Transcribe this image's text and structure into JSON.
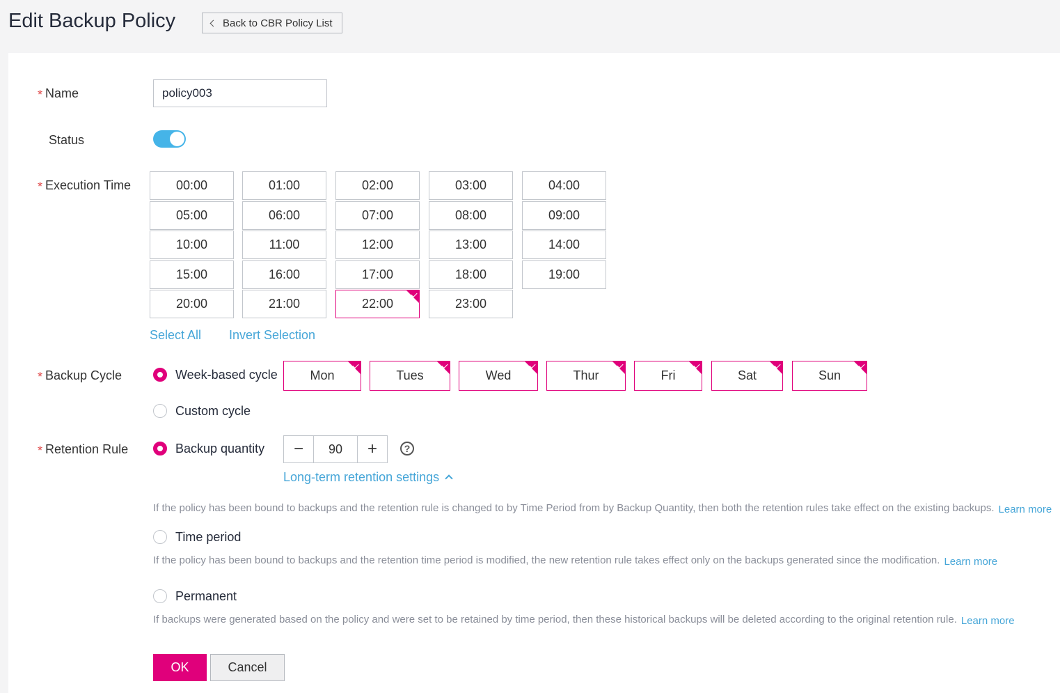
{
  "page": {
    "title": "Edit Backup Policy",
    "back_label": "Back to CBR Policy List"
  },
  "form": {
    "name_label": "Name",
    "name_value": "policy003",
    "status_label": "Status",
    "status_enabled": true,
    "execution_time_label": "Execution Time",
    "times": [
      "00:00",
      "01:00",
      "02:00",
      "03:00",
      "04:00",
      "05:00",
      "06:00",
      "07:00",
      "08:00",
      "09:00",
      "10:00",
      "11:00",
      "12:00",
      "13:00",
      "14:00",
      "15:00",
      "16:00",
      "17:00",
      "18:00",
      "19:00",
      "20:00",
      "21:00",
      "22:00",
      "23:00"
    ],
    "selected_times": [
      "22:00"
    ],
    "select_all": "Select All",
    "invert_selection": "Invert Selection",
    "backup_cycle_label": "Backup Cycle",
    "week_based_cycle": "Week-based cycle",
    "custom_cycle": "Custom cycle",
    "backup_cycle_selected": "Week-based cycle",
    "days": [
      "Mon",
      "Tues",
      "Wed",
      "Thur",
      "Fri",
      "Sat",
      "Sun"
    ],
    "selected_days": [
      "Mon",
      "Tues",
      "Wed",
      "Thur",
      "Fri",
      "Sat",
      "Sun"
    ],
    "retention_rule_label": "Retention Rule",
    "backup_quantity_label": "Backup quantity",
    "backup_quantity_value": "90",
    "stepper_minus": "−",
    "stepper_plus": "+",
    "help_glyph": "?",
    "retention_selected": "Backup quantity",
    "long_term_link": "Long-term retention settings",
    "note_quantity": "If the policy has been bound to backups and the retention rule is changed to by Time Period from by Backup Quantity, then both the retention rules take effect on the existing backups.",
    "time_period_label": "Time period",
    "note_time_period": "If the policy has been bound to backups and the retention time period is modified, the new retention rule takes effect only on the backups generated since the modification.",
    "permanent_label": "Permanent",
    "note_permanent": "If backups were generated based on the policy and were set to be retained by time period, then these historical backups will be deleted according to the original retention rule.",
    "learn_more": "Learn more",
    "ok": "OK",
    "cancel": "Cancel"
  },
  "colors": {
    "accent": "#e0007b",
    "link": "#46a6d8",
    "toggle_on": "#45b4e8",
    "required": "#e04a4a"
  }
}
